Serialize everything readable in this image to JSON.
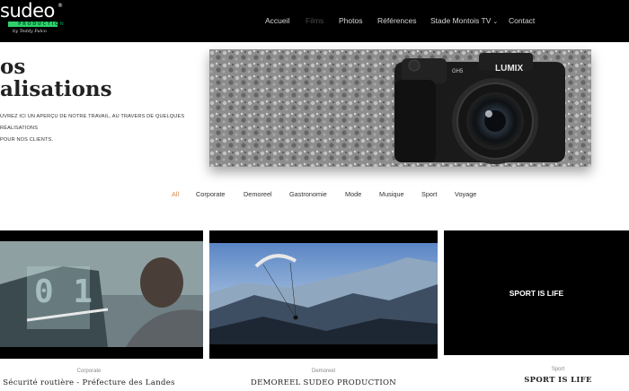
{
  "brand": {
    "word": "sudeo",
    "registered": "®",
    "production": "PRODUCTION",
    "signature": "by Teddy Falco"
  },
  "nav": {
    "items": [
      {
        "label": "Accueil"
      },
      {
        "label": "Films"
      },
      {
        "label": "Photos"
      },
      {
        "label": "Références"
      },
      {
        "label": "Stade Montois TV"
      },
      {
        "label": "Contact"
      }
    ],
    "active": "Films"
  },
  "hero": {
    "title_line1": "os",
    "title_line2": "alisations",
    "description_line1": "uvrez ici un aperçu de notre travail, au travers de quelques réalisations",
    "description_line2": "pour nos clients.",
    "image_camera_brand": "LUMIX",
    "image_camera_model": "GH5"
  },
  "filters": {
    "items": [
      "All",
      "Corporate",
      "Demoreel",
      "Gastronomie",
      "Mode",
      "Musique",
      "Sport",
      "Voyage"
    ],
    "active": "All"
  },
  "cards": [
    {
      "category": "Corporate",
      "title": "Sécurité routière - Préfecture des Landes"
    },
    {
      "category": "Demoreel",
      "title": "DEMOREEL SUDEO PRODUCTION"
    },
    {
      "category": "Sport",
      "title": "SPORT IS LIFE",
      "overlay": "SPORT IS LIFE"
    }
  ],
  "colors": {
    "header_bg": "#000000",
    "active_filter": "#d98a4f",
    "brand_green": "#2fd06a"
  }
}
